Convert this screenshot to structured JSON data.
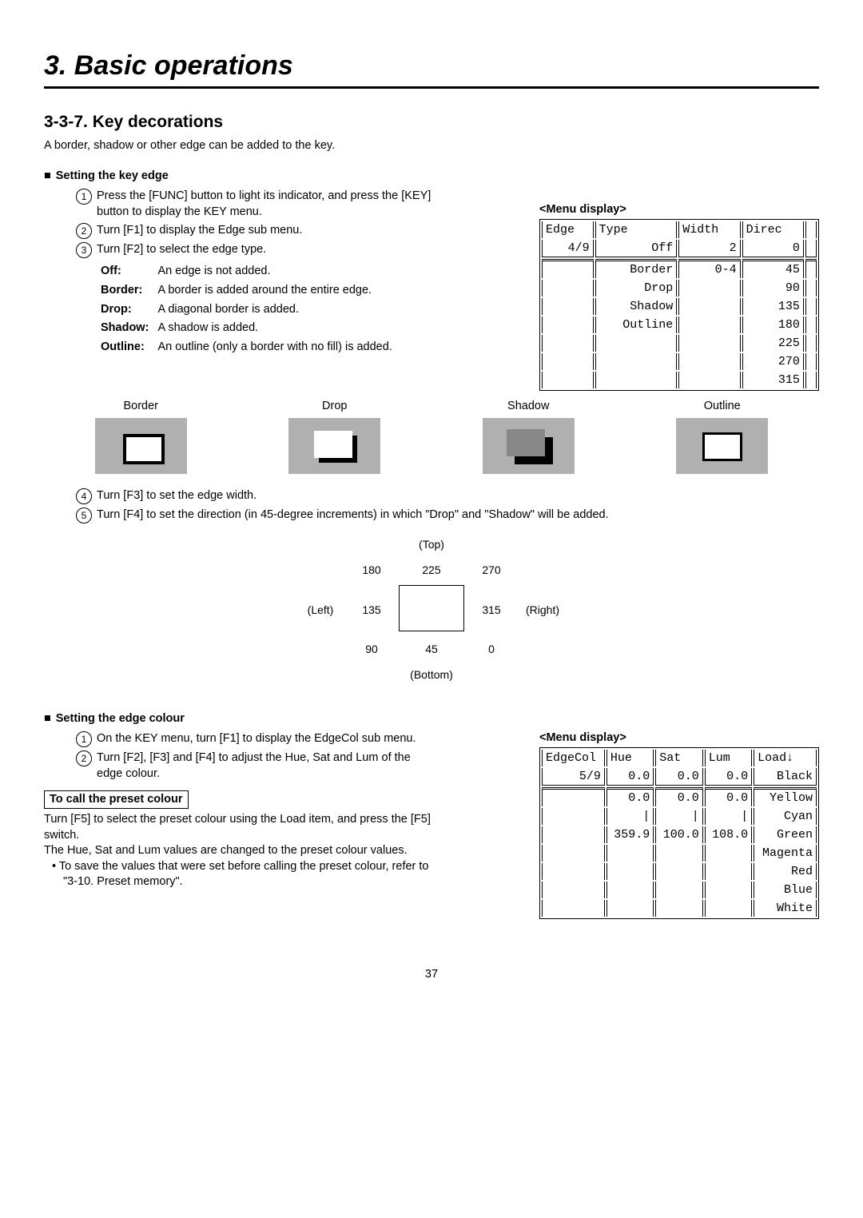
{
  "page_number": "37",
  "chapter_title": "3. Basic operations",
  "section_title": "3-3-7. Key decorations",
  "intro_line": "A border, shadow or other edge can be added to the key.",
  "edge_heading": "Setting the key edge",
  "steps_edge": {
    "s1": "Press the [FUNC] button to light its indicator, and press the [KEY] button to display the KEY menu.",
    "s2": "Turn [F1] to display the Edge sub menu.",
    "s3": "Turn [F2] to select the edge type.",
    "s4": "Turn [F3] to set the edge width.",
    "s5": "Turn [F4] to set the direction (in 45-degree increments) in which \"Drop\" and \"Shadow\" will be added."
  },
  "edge_types": {
    "off_l": "Off",
    "off_d": "An edge is not added.",
    "border_l": "Border",
    "border_d": "A border is added around the entire edge.",
    "drop_l": "Drop",
    "drop_d": "A diagonal border is added.",
    "shadow_l": "Shadow",
    "shadow_d": "A shadow is added.",
    "outline_l": "Outline",
    "outline_d": "An outline (only a border with no fill) is added."
  },
  "menu1_label": "<Menu display>",
  "menu1": {
    "h1": "Edge",
    "h2": "Type",
    "h3": "Width",
    "h4": "Direc",
    "r1a": "4/9",
    "r1b": "Off",
    "r1c": "2",
    "r1d": "0",
    "opt1": "Border",
    "w1": "0-4",
    "d1": "45",
    "opt2": "Drop",
    "d2": "90",
    "opt3": "Shadow",
    "d3": "135",
    "opt4": "Outline",
    "d4": "180",
    "d5": "225",
    "d6": "270",
    "d7": "315"
  },
  "preview_labels": {
    "border": "Border",
    "drop": "Drop",
    "shadow": "Shadow",
    "outline": "Outline"
  },
  "dir": {
    "top": "(Top)",
    "bottom": "(Bottom)",
    "left": "(Left)",
    "right": "(Right)",
    "a180": "180",
    "a225": "225",
    "a270": "270",
    "a135": "135",
    "a315": "315",
    "a90": "90",
    "a45": "45",
    "a0": "0"
  },
  "colour_heading": "Setting the edge colour",
  "steps_colour": {
    "s1": "On the KEY menu, turn [F1] to display the EdgeCol sub menu.",
    "s2": "Turn [F2], [F3] and [F4] to adjust the Hue, Sat and Lum of the edge colour."
  },
  "preset_box": "To call the preset colour",
  "preset_text1": "Turn [F5] to select the preset colour using the Load item, and press the [F5] switch.",
  "preset_text2": "The Hue, Sat and Lum values are changed to the preset colour values.",
  "preset_bullet": "To save the values that were set before calling the preset colour, refer to \"3-10. Preset memory\".",
  "menu2_label": "<Menu display>",
  "menu2": {
    "h1": "EdgeCol",
    "h2": "Hue",
    "h3": "Sat",
    "h4": "Lum",
    "h5": "Load↓",
    "r1a": "5/9",
    "r1b": "0.0",
    "r1c": "0.0",
    "r1d": "0.0",
    "r1e": "Black",
    "r2b": "0.0",
    "r2c": "0.0",
    "r2d": "0.0",
    "r2e": "Yellow",
    "r3b": "|",
    "r3c": "|",
    "r3d": "|",
    "r3e": "Cyan",
    "r4b": "359.9",
    "r4c": "100.0",
    "r4d": "108.0",
    "r4e": "Green",
    "r5e": "Magenta",
    "r6e": "Red",
    "r7e": "Blue",
    "r8e": "White"
  }
}
